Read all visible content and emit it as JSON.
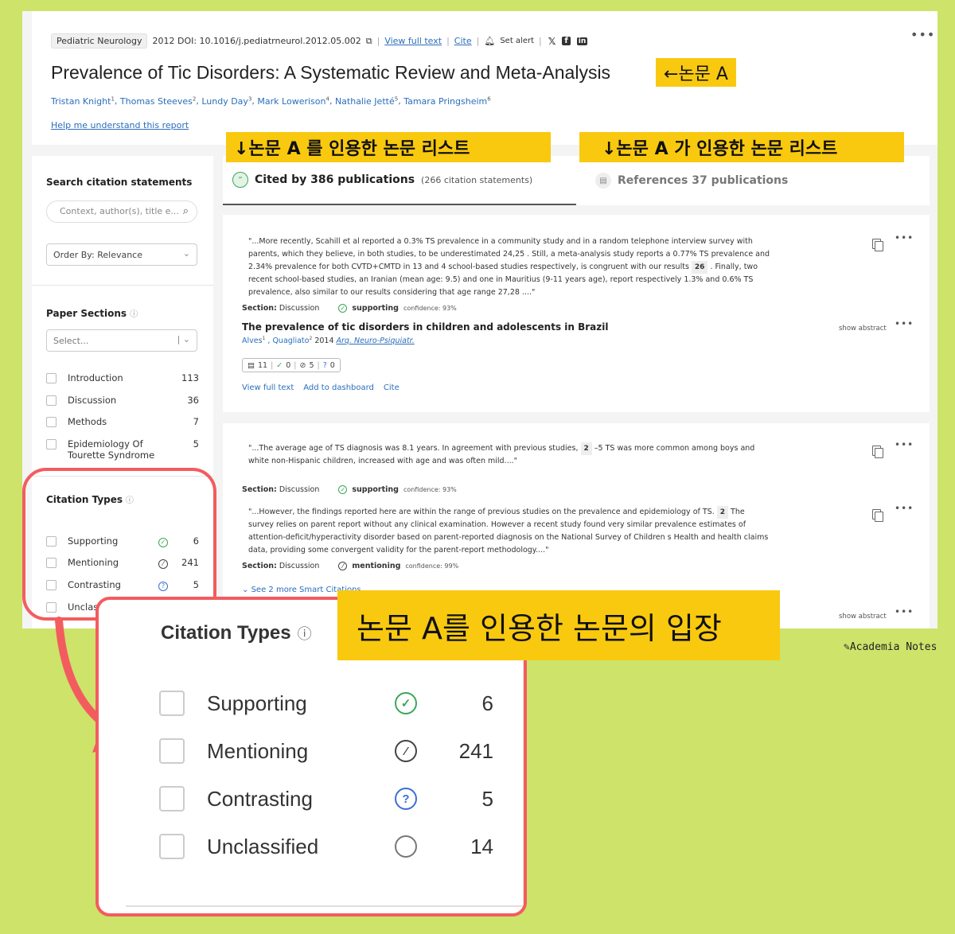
{
  "paper": {
    "journal": "Pediatric Neurology",
    "year_doi": "2012 DOI: 10.1016/j.pediatrneurol.2012.05.002",
    "view_full_text": "View full text",
    "cite": "Cite",
    "set_alert": "Set alert",
    "title": "Prevalence of Tic Disorders: A Systematic Review and Meta-Analysis",
    "authors": [
      {
        "name": "Tristan Knight",
        "sup": "1"
      },
      {
        "name": "Thomas Steeves",
        "sup": "2"
      },
      {
        "name": "Lundy Day",
        "sup": "3"
      },
      {
        "name": "Mark Lowerison",
        "sup": "4"
      },
      {
        "name": "Nathalie Jetté",
        "sup": "5"
      },
      {
        "name": "Tamara Pringsheim",
        "sup": "6"
      }
    ],
    "help_link": "Help me understand this report"
  },
  "annotations": {
    "paper_a": "←논문 A",
    "cited_by_list": "↓논문 A 를 인용한 논문 리스트",
    "references_list": "↓논문 A 가 인용한 논문 리스트",
    "stance": "논문 A를 인용한 논문의 입장"
  },
  "sidebar": {
    "search_title": "Search citation statements",
    "search_placeholder": "Context, author(s), title e...",
    "order_by": "Order By: Relevance",
    "sections_title": "Paper Sections",
    "sections_select": "Select...",
    "sections": [
      {
        "label": "Introduction",
        "count": "113"
      },
      {
        "label": "Discussion",
        "count": "36"
      },
      {
        "label": "Methods",
        "count": "7"
      },
      {
        "label": "Epidemiology Of Tourette Syndrome",
        "count": "5"
      }
    ],
    "types_title": "Citation Types",
    "types": [
      {
        "label": "Supporting",
        "count": "6"
      },
      {
        "label": "Mentioning",
        "count": "241"
      },
      {
        "label": "Contrasting",
        "count": "5"
      },
      {
        "label": "Unclassified",
        "count": "14"
      }
    ]
  },
  "tabs": {
    "cited_by": "Cited by 386 publications",
    "cited_by_sub": "(266 citation statements)",
    "references": "References 37 publications"
  },
  "card1": {
    "quote_a": "\"...More recently, Scahill et al reported a 0.3% TS prevalence in a community study and in a random telephone interview survey with parents, which they believe, in both studies, to be underestimated 24,25 . Still, a meta-analysis study reports a 0.77% TS prevalence and 2.34% prevalence for both CVTD+CMTD in 13 and 4 school-based studies respectively, is congruent with our results ",
    "quote_num": "26",
    "quote_b": " . Finally, two recent school-based studies, an Iranian (mean age: 9.5) and one in Mauritius (9-11 years age), report respectively 1.3% and 0.6% TS prevalence, also similar to our results considering that age range 27,28 ....\"",
    "section_label": "Section:",
    "section": "Discussion",
    "stance": "supporting",
    "confidence": "confidence: 93%",
    "paper_title": "The prevalence of tic disorders in children and adolescents in Brazil",
    "author1": "Alves",
    "author1_sup": "1",
    "author2": "Quagliato",
    "author2_sup": "2",
    "year": "2014",
    "venue": "Arq. Neuro-Psiquiatr.",
    "show_abstract": "show abstract",
    "counts": {
      "statements": "11",
      "supporting": "0",
      "mentioning": "5",
      "contrasting": "0"
    },
    "actions": [
      "View full text",
      "Add to dashboard",
      "Cite"
    ]
  },
  "card2": {
    "quote1_a": "\"...The average age of TS diagnosis was 8.1 years. In agreement with previous studies, ",
    "quote1_num": "2",
    "quote1_b": " –5 TS was more common among boys and white non-Hispanic children, increased with age and was often mild....\"",
    "section_label": "Section:",
    "section1": "Discussion",
    "stance1": "supporting",
    "confidence1": "confidence: 93%",
    "quote2_a": "\"...However, the findings reported here are within the range of previous studies on the prevalence and epidemiology of TS. ",
    "quote2_num": "2",
    "quote2_b": " The survey relies on parent report without any clinical examination. However a recent study found very similar prevalence estimates of attention-deficit/hyperactivity disorder based on parent-reported diagnosis on the National Survey of Children s Health and health claims data, providing some convergent validity for the parent-report methodology....\"",
    "section2": "Discussion",
    "stance2": "mentioning",
    "confidence2": "confidence: 99%",
    "see_more": "See 2 more Smart Citations",
    "show_abstract": "show abstract"
  },
  "zoom": {
    "title": "Citation Types",
    "types": [
      {
        "label": "Supporting",
        "count": "6"
      },
      {
        "label": "Mentioning",
        "count": "241"
      },
      {
        "label": "Contrasting",
        "count": "5"
      },
      {
        "label": "Unclassified",
        "count": "14"
      }
    ]
  },
  "brand": "Academia Notes",
  "colors": {
    "background": "#cde36a",
    "highlight": "#f9c90f",
    "callout": "#f35c5f",
    "link": "#2a6ebb",
    "supporting": "#3aa757",
    "contrasting": "#3b6fd6"
  }
}
